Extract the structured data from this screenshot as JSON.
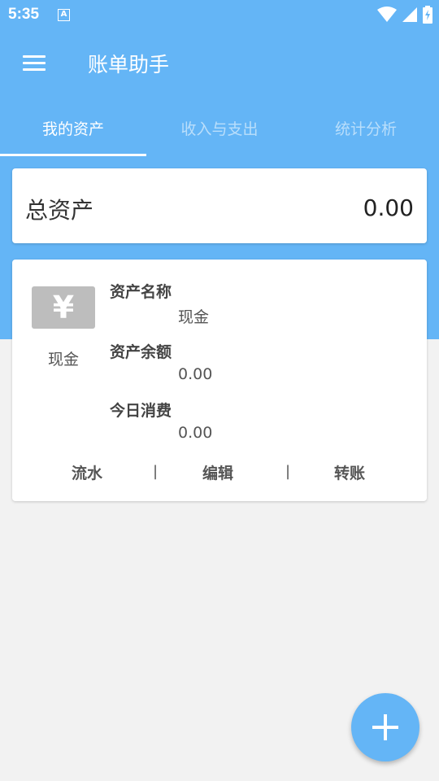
{
  "statusbar": {
    "time": "5:35",
    "notification_icon": "A"
  },
  "icons": [
    "menu-icon",
    "wifi-icon",
    "signal-icon",
    "battery-icon",
    "yen-icon",
    "add-icon"
  ],
  "colors": {
    "primary": "#64B5F6",
    "background": "#F2F2F2",
    "card": "#FFFFFF",
    "icon_bg": "#BDBDBD"
  },
  "app": {
    "title": "账单助手"
  },
  "tabs": [
    {
      "label": "我的资产",
      "active": true
    },
    {
      "label": "收入与支出",
      "active": false
    },
    {
      "label": "统计分析",
      "active": false
    }
  ],
  "summary": {
    "label": "总资产",
    "value": "0.00"
  },
  "asset": {
    "icon_glyph": "¥",
    "type_label": "现金",
    "name_label": "资产名称",
    "name_value": "现金",
    "balance_label": "资产余额",
    "balance_value": "0.00",
    "today_label": "今日消费",
    "today_value": "0.00",
    "actions": {
      "flow": "流水",
      "edit": "编辑",
      "transfer": "转账",
      "separator": "|"
    }
  }
}
